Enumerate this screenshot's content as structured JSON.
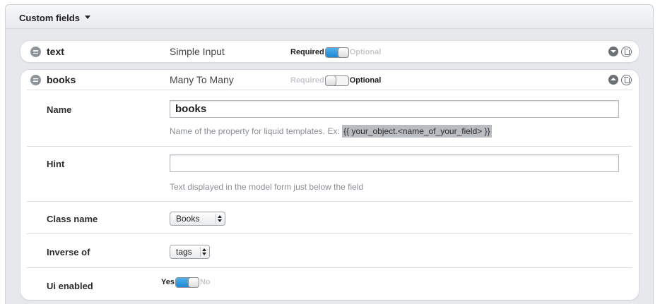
{
  "panel": {
    "title": "Custom fields"
  },
  "fields": [
    {
      "name": "text",
      "type": "Simple Input",
      "required_label": "Required",
      "optional_label": "Optional",
      "state": "required"
    },
    {
      "name": "books",
      "type": "Many To Many",
      "required_label": "Required",
      "optional_label": "Optional",
      "state": "optional",
      "expanded": true,
      "properties": {
        "name": {
          "label": "Name",
          "value": "books",
          "hint": "Name of the property for liquid templates. Ex:",
          "hint_code": "{{ your_object.<name_of_your_field> }}"
        },
        "hint": {
          "label": "Hint",
          "value": "",
          "hint": "Text displayed in the model form just below the field"
        },
        "class_name": {
          "label": "Class name",
          "value": "Books"
        },
        "inverse_of": {
          "label": "Inverse of",
          "value": "tags"
        },
        "ui_enabled": {
          "label": "Ui enabled",
          "yes_label": "Yes",
          "no_label": "No",
          "state": "yes"
        }
      }
    }
  ],
  "icons": {
    "panel_toggle": "caret-down-icon",
    "drag": "drag-handle-icon",
    "expand": "chevron-down-icon",
    "collapse": "chevron-up-icon",
    "delete": "trash-icon"
  },
  "colors": {
    "toggle_on": "#1e88d6",
    "panel_bg": "#e6e8ec"
  }
}
